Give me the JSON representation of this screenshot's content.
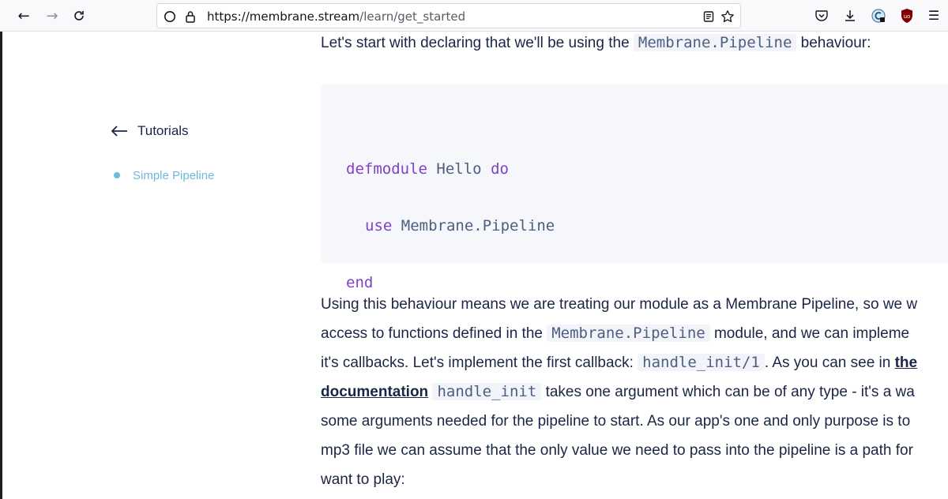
{
  "browser": {
    "url_host": "https://membrane.stream",
    "url_path": "/learn/get_started",
    "back_icon": "←",
    "forward_icon": "→",
    "reload_icon": "⟳",
    "menu_icon": "☰",
    "ublock_badge": "uo"
  },
  "sidebar": {
    "back_label": "Tutorials",
    "items": [
      {
        "label": "Simple Pipeline"
      }
    ]
  },
  "content": {
    "intro": {
      "before": "Let's start with declaring that we'll be using the ",
      "code": "Membrane.Pipeline",
      "after": " behaviour:"
    },
    "code_block": {
      "line1_kw1": "defmodule",
      "line1_mod": "Hello",
      "line1_kw2": "do",
      "line2_kw": "use",
      "line2_mod": "Membrane.Pipeline",
      "line3_kw": "end"
    },
    "paragraph": {
      "l1": "Using this behaviour means we are treating our module as a Membrane Pipeline, so we w",
      "l2_before": "access to functions defined in the ",
      "l2_code": "Membrane.Pipeline",
      "l2_after": " module, and we can impleme",
      "l3_before": "it's callbacks. Let's implement the first callback: ",
      "l3_code": "handle_init/1",
      "l3_after": ". As you can see in ",
      "l3_link": "the",
      "l4_link": "documentation",
      "l4_code": "handle_init",
      "l4_after": " takes one argument which can be of any type - it's a wa",
      "l5": "some arguments needed for the pipeline to start. As our app's one and only purpose is to",
      "l6": "mp3 file we can assume that the only value we need to pass into the pipeline is a path for",
      "l7": "want to play:"
    }
  }
}
